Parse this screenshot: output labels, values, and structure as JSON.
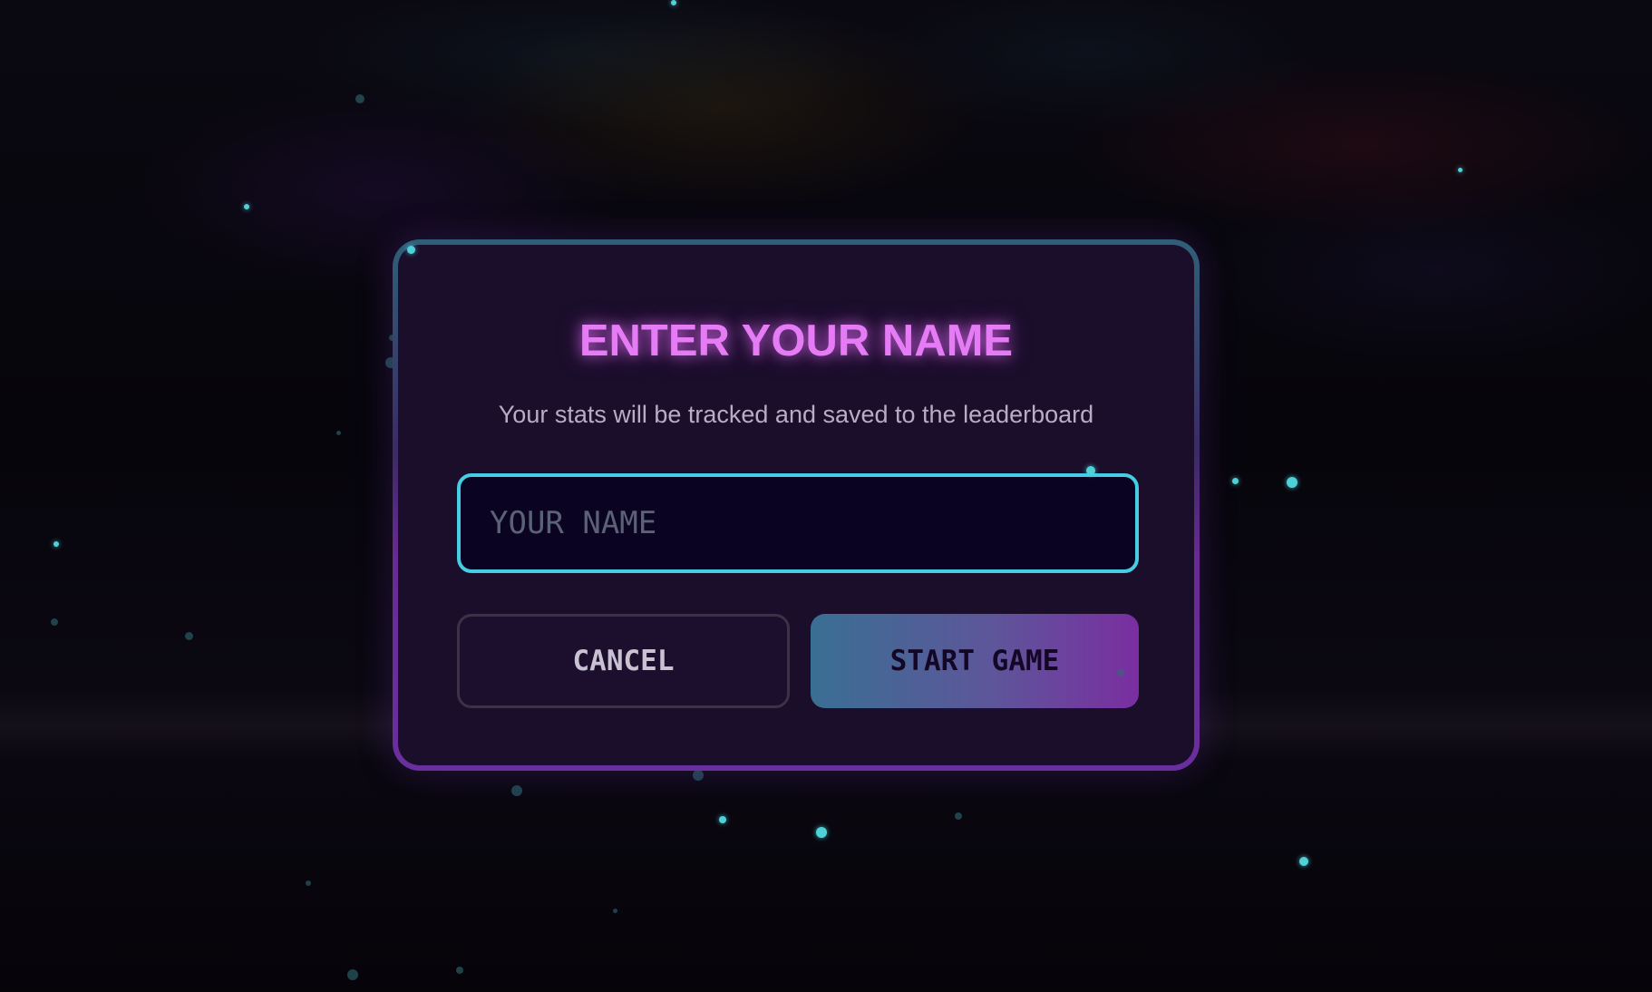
{
  "dialog": {
    "title": "ENTER YOUR NAME",
    "subtitle": "Your stats will be tracked and saved to the leaderboard",
    "name_input": {
      "value": "",
      "placeholder": "YOUR NAME"
    },
    "cancel_label": "CANCEL",
    "start_label": "START GAME"
  },
  "colors": {
    "title": "#e57bf5",
    "input_border": "#45cde4",
    "particle": "#4fd1d9",
    "start_gradient_from": "#3a6f93",
    "start_gradient_to": "#7a2ea0"
  }
}
